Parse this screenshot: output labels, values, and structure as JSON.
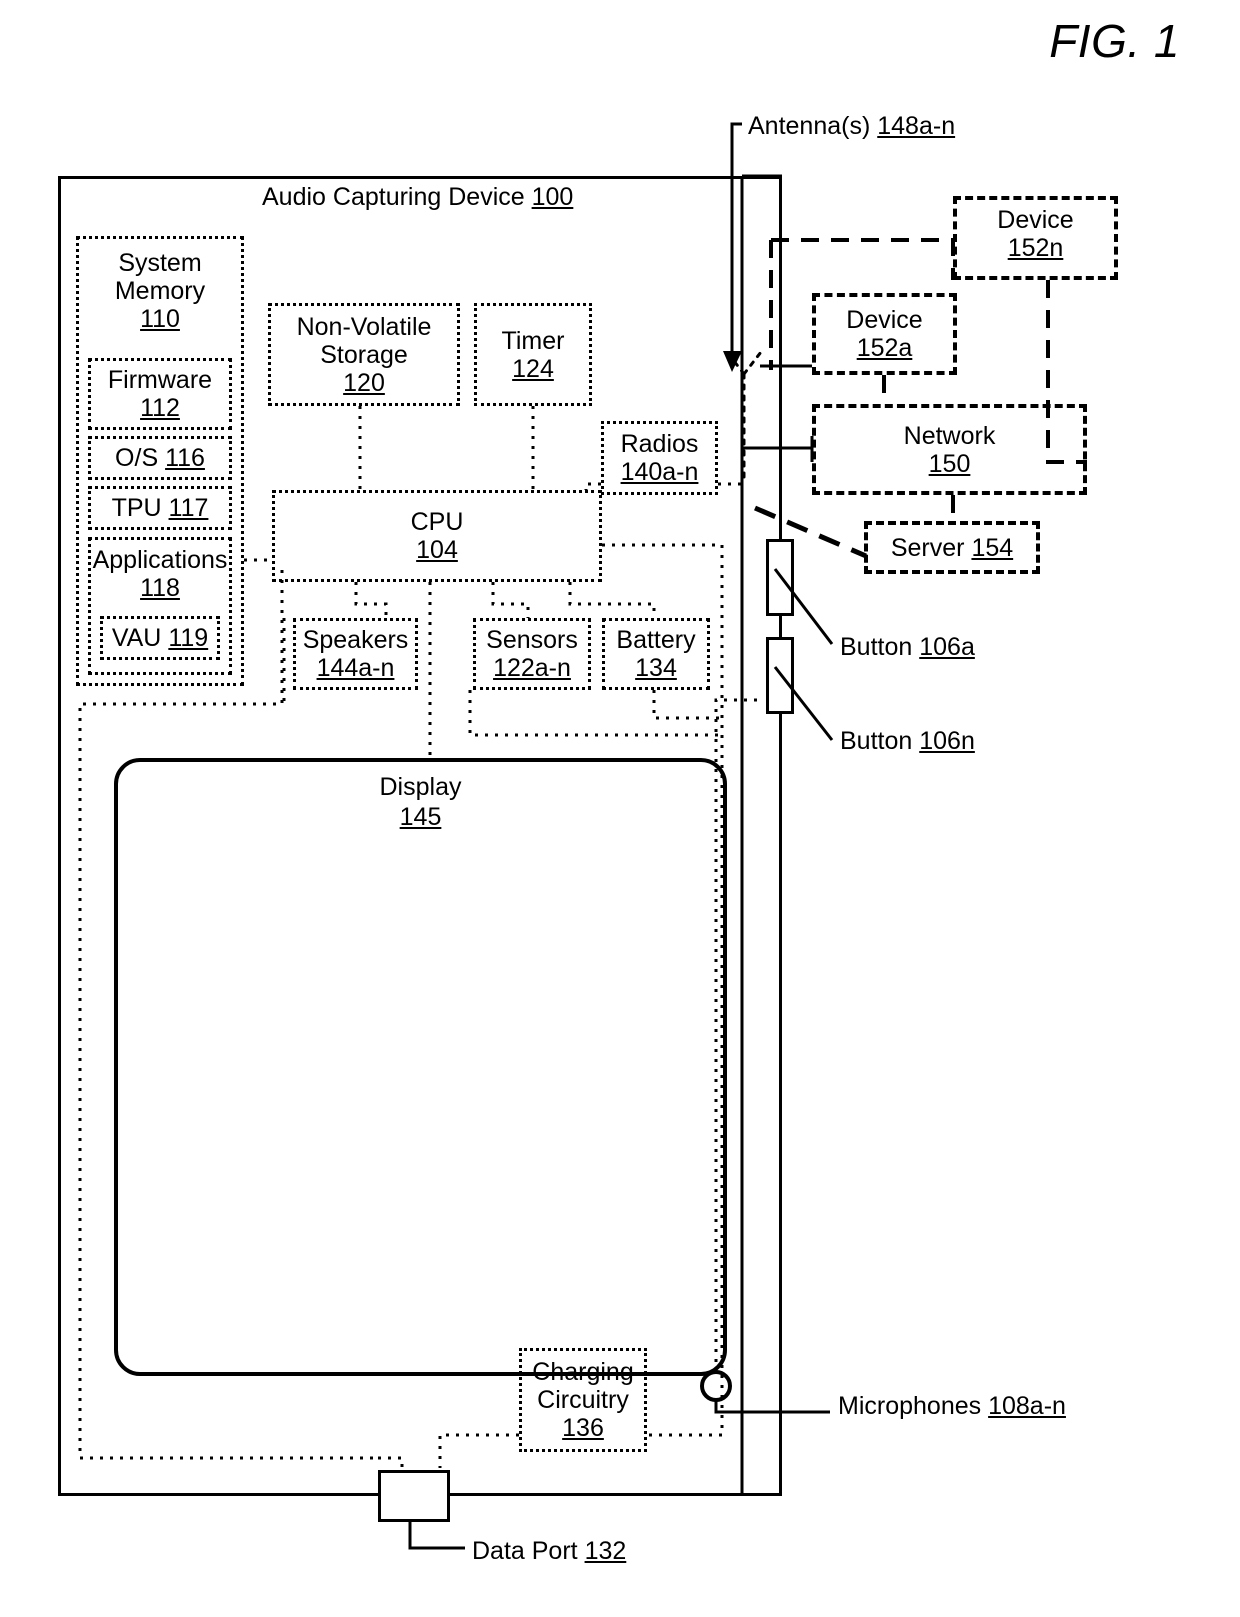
{
  "figure": {
    "title": "FIG. 1"
  },
  "device": {
    "title_text": "Audio Capturing Device",
    "title_num": "100"
  },
  "blocks": {
    "system_memory": {
      "line1": "System",
      "line2": "Memory",
      "num": "110"
    },
    "firmware": {
      "line1": "Firmware",
      "num": "112"
    },
    "os": {
      "label": "O/S",
      "num": "116"
    },
    "tpu": {
      "label": "TPU",
      "num": "117"
    },
    "applications": {
      "line1": "Applications",
      "num": "118"
    },
    "vau": {
      "label": "VAU",
      "num": "119"
    },
    "nonvolatile": {
      "line1": "Non-Volatile",
      "line2": "Storage",
      "num": "120"
    },
    "timer": {
      "line1": "Timer",
      "num": "124"
    },
    "cpu": {
      "line1": "CPU",
      "num": "104"
    },
    "radios": {
      "line1": "Radios",
      "num": "140a-n"
    },
    "speakers": {
      "line1": "Speakers",
      "num": "144a-n"
    },
    "sensors": {
      "line1": "Sensors",
      "num": "122a-n"
    },
    "battery": {
      "line1": "Battery",
      "num": "134"
    },
    "display": {
      "line1": "Display",
      "num": "145"
    },
    "charging": {
      "line1": "Charging",
      "line2": "Circuitry",
      "num": "136"
    }
  },
  "external": {
    "device_152n": {
      "line1": "Device",
      "num": "152n"
    },
    "device_152a": {
      "line1": "Device",
      "num": "152a"
    },
    "network": {
      "line1": "Network",
      "num": "150"
    },
    "server": {
      "label": "Server",
      "num": "154"
    }
  },
  "callouts": {
    "antennas": {
      "label": "Antenna(s)",
      "num": "148a-n"
    },
    "button_a": {
      "label": "Button",
      "num": "106a"
    },
    "button_n": {
      "label": "Button",
      "num": "106n"
    },
    "microphones": {
      "label": "Microphones",
      "num": "108a-n"
    },
    "data_port": {
      "label": "Data Port",
      "num": "132"
    }
  },
  "colors": {
    "ink": "#000000",
    "paper": "#ffffff"
  }
}
